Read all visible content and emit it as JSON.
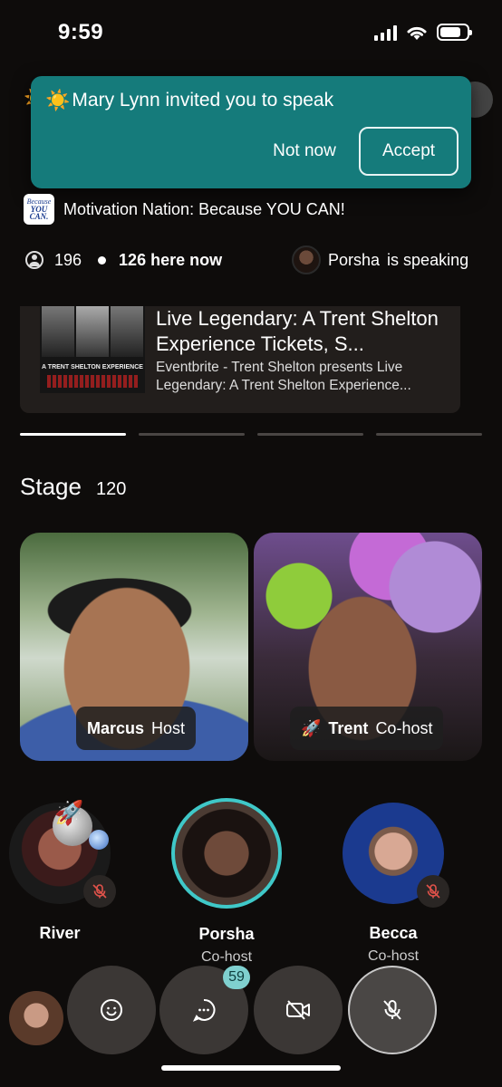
{
  "status_bar": {
    "time": "9:59"
  },
  "notification": {
    "text": "Mary Lynn  invited you to speak",
    "secondary_label": "Not now",
    "primary_label": "Accept"
  },
  "club": {
    "logo_text_1": "Because",
    "logo_text_2": "YOU",
    "logo_text_3": "CAN.",
    "name": "Motivation Nation: Because YOU CAN!"
  },
  "stats": {
    "members": "196",
    "here_now": "126 here now",
    "speaker_name": "Porsha",
    "speaking_suffix": "is speaking"
  },
  "link_card": {
    "thumb_caption": "A TRENT SHELTON EXPERIENCE",
    "title": "Live Legendary: A Trent Shelton Experience Tickets, S...",
    "description": "Eventbrite - Trent Shelton presents Live Legendary: A Trent Shelton Experience..."
  },
  "pager": {
    "count": 4,
    "active_index": 0
  },
  "stage": {
    "title": "Stage",
    "count": "120",
    "videos": [
      {
        "name": "Marcus",
        "role": "Host",
        "emoji": ""
      },
      {
        "name": "Trent",
        "role": "Co-host",
        "emoji": "🚀"
      }
    ]
  },
  "speakers": [
    {
      "name": "River",
      "role": "",
      "muted": true
    },
    {
      "name": "Porsha",
      "role": "Co-host",
      "muted": false,
      "speaking": true
    },
    {
      "name": "Becca",
      "role": "Co-host",
      "muted": true
    }
  ],
  "controls": {
    "chat_badge": "59",
    "icons": [
      "emoji-icon",
      "chat-icon",
      "video-off-icon",
      "mic-off-icon"
    ]
  },
  "colors": {
    "background": "#0e0c0b",
    "notification": "#157b7b",
    "accent_ring": "#3fc8c8",
    "badge": "#7fd0cf"
  }
}
